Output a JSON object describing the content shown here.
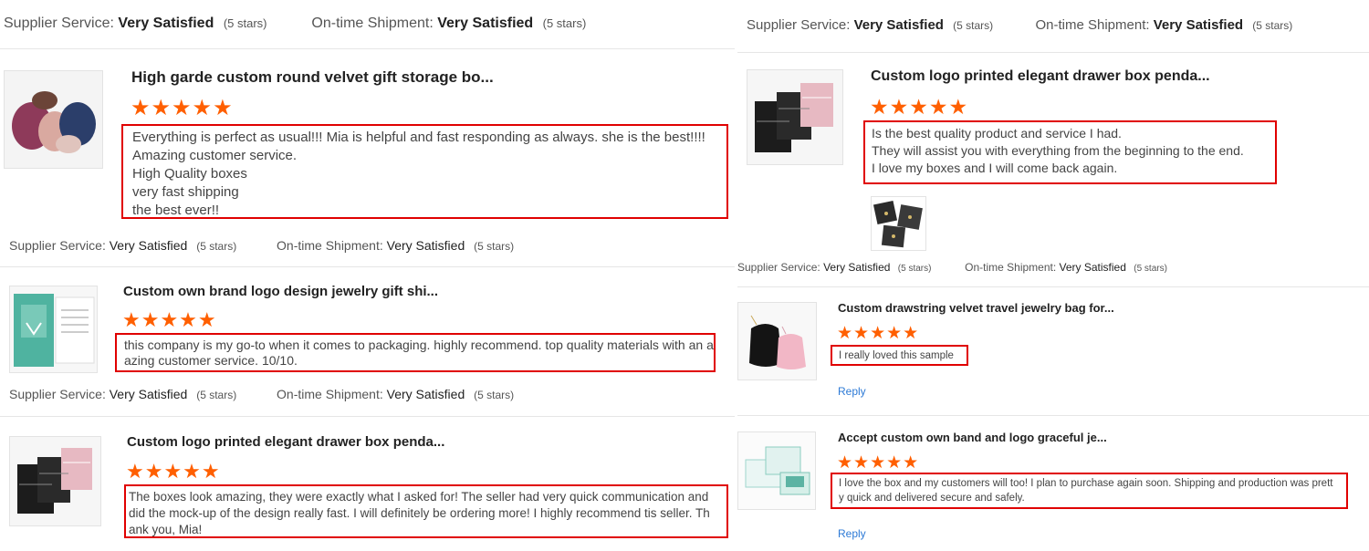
{
  "labels": {
    "supplier_service": "Supplier Service:",
    "ontime_shipment": "On-time Shipment:",
    "very_satisfied": "Very Satisfied",
    "five_stars": "(5 stars)",
    "reply": "Reply"
  },
  "stars_glyph": "★★★★★",
  "left": {
    "reviews": [
      {
        "title": "High garde custom round velvet gift storage bo...",
        "rating": 5,
        "lines": [
          "Everything is perfect as usual!!! Mia is helpful and fast responding as always. she is the best!!!!",
          "Amazing customer service.",
          "High Quality boxes",
          "very fast shipping",
          "the best ever!!"
        ]
      },
      {
        "title": "Custom own brand logo design jewelry gift shi...",
        "rating": 5,
        "lines": [
          "this company is my go-to when it comes to packaging. highly recommend. top quality materials with an am",
          "azing customer service. 10/10."
        ]
      },
      {
        "title": "Custom logo printed elegant drawer box penda...",
        "rating": 5,
        "lines": [
          "The boxes look amazing, they were exactly what I asked for! The seller had very quick communication and",
          "did the mock-up of the design really fast. I will definitely be ordering more! I highly recommend tis seller. Th",
          "ank you, Mia!"
        ]
      }
    ]
  },
  "right": {
    "reviews": [
      {
        "title": "Custom logo printed elegant drawer box penda...",
        "rating": 5,
        "lines": [
          "Is the best quality product and service I had.",
          "They will assist you with everything from the beginning to the end.",
          "I love my boxes and I will come back again."
        ]
      },
      {
        "title": "Custom drawstring velvet travel jewelry bag for...",
        "rating": 5,
        "lines": [
          "I really loved this sample"
        ]
      },
      {
        "title": "Accept custom own band and logo graceful je...",
        "rating": 5,
        "lines": [
          "I love the box and my customers will too! I plan to purchase again soon. Shipping and production was prett",
          "y quick and delivered secure and safely."
        ]
      }
    ]
  },
  "colors": {
    "star": "#ff5f00",
    "highlight_border": "#e00000",
    "reply_link": "#2d7ad6",
    "divider": "#e6e6e6"
  },
  "icons": {
    "product_thumbnails": [
      "velvet-pouches-image",
      "gift-card-image",
      "drawer-boxes-image",
      "drawer-boxes-image",
      "velvet-bags-image",
      "clear-boxes-image"
    ],
    "review_photo": "boxes-photo-image"
  }
}
